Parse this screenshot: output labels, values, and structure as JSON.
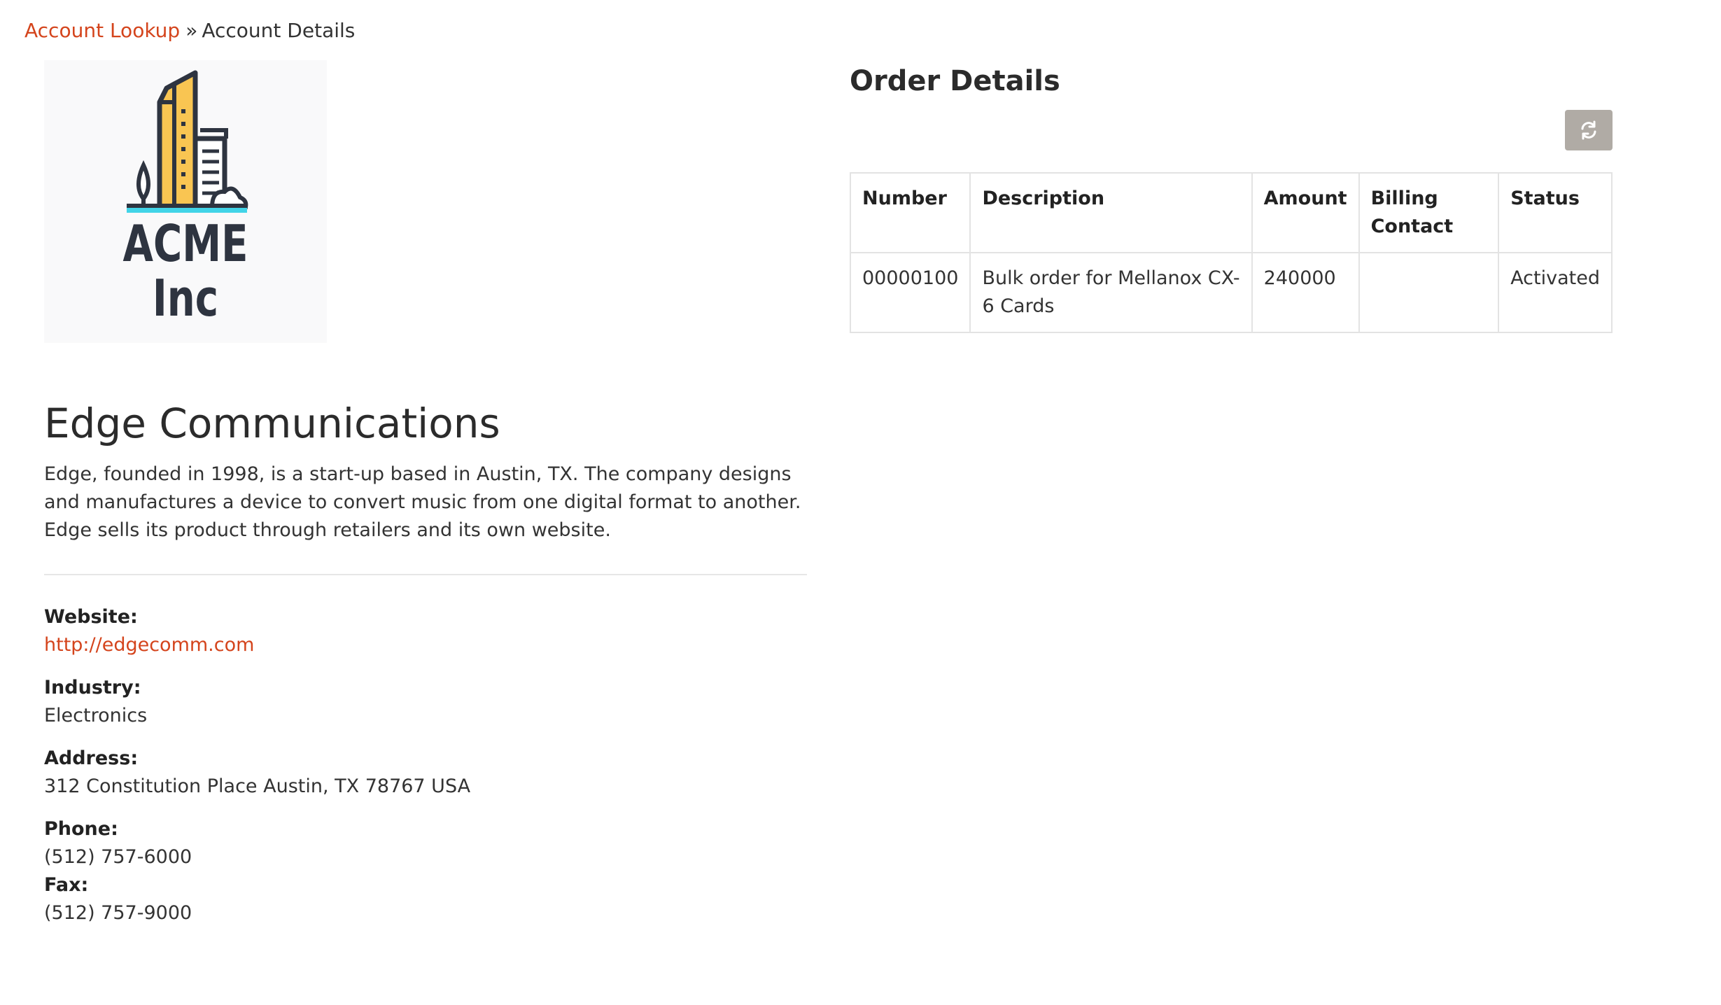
{
  "breadcrumb": {
    "parent_label": "Account Lookup",
    "separator": "»",
    "current_label": "Account Details"
  },
  "logo": {
    "line1": "ACME",
    "line2": "Inc"
  },
  "account": {
    "name": "Edge Communications",
    "description": "Edge, founded in 1998, is a start-up based in Austin, TX. The company designs and manufactures a device to convert music from one digital format to another. Edge sells its product through retailers and its own website.",
    "website_label": "Website:",
    "website": "http://edgecomm.com",
    "industry_label": "Industry:",
    "industry": "Electronics",
    "address_label": "Address:",
    "address": "312 Constitution Place Austin, TX 78767 USA",
    "phone_label": "Phone:",
    "phone": "(512) 757-6000",
    "fax_label": "Fax:",
    "fax": "(512) 757-9000"
  },
  "orders": {
    "title": "Order Details",
    "refresh_icon": "refresh-icon",
    "columns": {
      "number": "Number",
      "description": "Description",
      "amount": "Amount",
      "billing_contact": "Billing Contact",
      "status": "Status"
    },
    "rows": [
      {
        "number": "00000100",
        "description": "Bulk order for Mellanox CX-6 Cards",
        "amount": "240000",
        "billing_contact": "",
        "status": "Activated"
      }
    ]
  },
  "colors": {
    "link": "#d4441c",
    "refresh_button": "#b0aba5",
    "logo_building": "#f9c552",
    "logo_text": "#2e3440",
    "logo_ground": "#42d4e8"
  }
}
